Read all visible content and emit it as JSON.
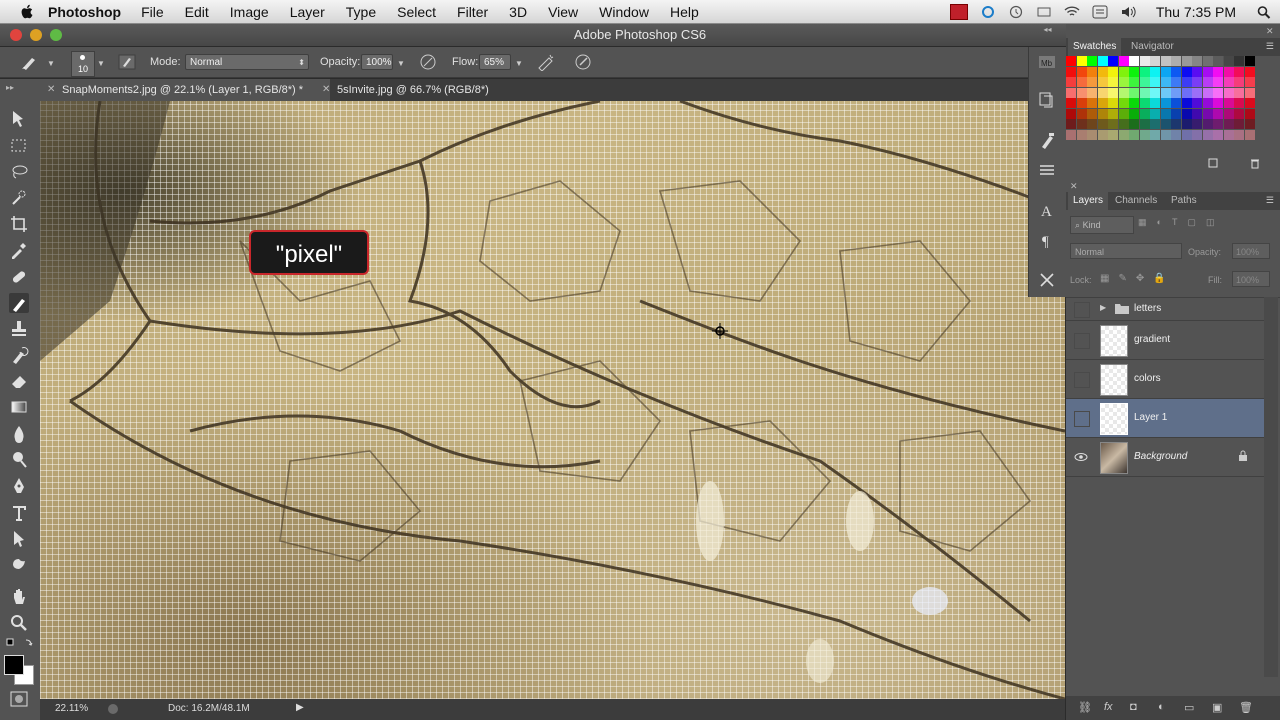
{
  "menubar": {
    "app_name": "Photoshop",
    "items": [
      "File",
      "Edit",
      "Image",
      "Layer",
      "Type",
      "Select",
      "Filter",
      "3D",
      "View",
      "Window",
      "Help"
    ],
    "clock": "Thu 7:35 PM"
  },
  "window": {
    "title": "Adobe Photoshop CS6"
  },
  "options_bar": {
    "brush_size": "10",
    "mode_label": "Mode:",
    "mode_value": "Normal",
    "opacity_label": "Opacity:",
    "opacity_value": "100%",
    "flow_label": "Flow:",
    "flow_value": "65%"
  },
  "document_tabs": [
    {
      "label": "SnapMoments2.jpg @ 22.1% (Layer 1, RGB/8*) *",
      "active": true
    },
    {
      "label": "5sInvite.jpg @ 66.7% (RGB/8*)",
      "active": false
    }
  ],
  "canvas": {
    "callout_text": "\"pixel\""
  },
  "status_bar": {
    "zoom": "22.11%",
    "doc_size": "Doc: 16.2M/48.1M"
  },
  "swatches_panel": {
    "tabs": [
      "Swatches",
      "Navigator"
    ],
    "colors": [
      "#ff0000",
      "#ffff00",
      "#00ff00",
      "#00ffff",
      "#0000ff",
      "#ff00ff",
      "#ffffff",
      "#ebebeb",
      "#d6d6d6",
      "#c2c2c2",
      "#adadad",
      "#999999",
      "#858585",
      "#707070",
      "#5c5c5c",
      "#474747",
      "#333333",
      "#000000"
    ]
  },
  "layers_panel": {
    "tabs": [
      "Layers",
      "Channels",
      "Paths"
    ],
    "kind_label": "Kind",
    "blend_mode": "Normal",
    "opacity_label": "Opacity:",
    "opacity_value": "100%",
    "lock_label": "Lock:",
    "fill_label": "Fill:",
    "fill_value": "100%",
    "layers": [
      {
        "name": "letters",
        "type": "group",
        "visible": false,
        "selected": false
      },
      {
        "name": "gradient",
        "type": "pixel",
        "visible": false,
        "selected": false
      },
      {
        "name": "colors",
        "type": "pixel",
        "visible": false,
        "selected": false
      },
      {
        "name": "Layer 1",
        "type": "pixel",
        "visible": false,
        "selected": true
      },
      {
        "name": "Background",
        "type": "background",
        "visible": true,
        "selected": false,
        "locked": true
      }
    ]
  }
}
